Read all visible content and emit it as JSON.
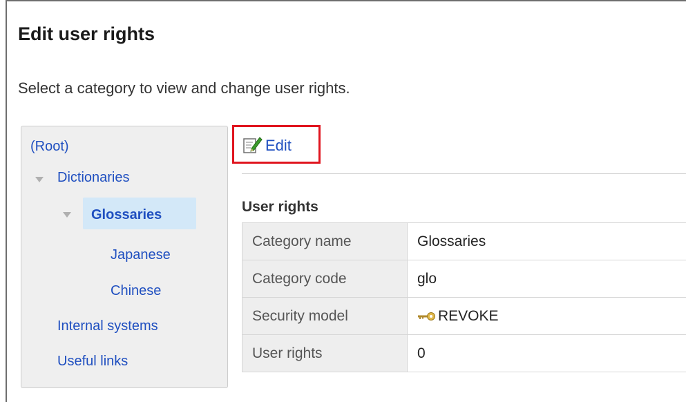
{
  "header": {
    "title": "Edit user rights",
    "description": "Select a category to view and change user rights."
  },
  "tree": {
    "root": "(Root)",
    "dictionaries": "Dictionaries",
    "glossaries": "Glossaries",
    "japanese": "Japanese",
    "chinese": "Chinese",
    "internal_systems": "Internal systems",
    "useful_links": "Useful links"
  },
  "toolbar": {
    "edit_label": "Edit",
    "edit_icon": "edit-document-icon"
  },
  "section": {
    "title": "User rights"
  },
  "rights_table": {
    "rows": [
      {
        "key": "Category name",
        "value": "Glossaries"
      },
      {
        "key": "Category code",
        "value": "glo"
      },
      {
        "key": "Security model",
        "value": "REVOKE",
        "icon": "key-icon"
      },
      {
        "key": "User rights",
        "value": "0"
      }
    ]
  },
  "colors": {
    "link": "#1f4fc0",
    "highlight_box": "#e0141e",
    "selected_bg": "#d3e8f8",
    "tree_bg": "#efefef"
  }
}
